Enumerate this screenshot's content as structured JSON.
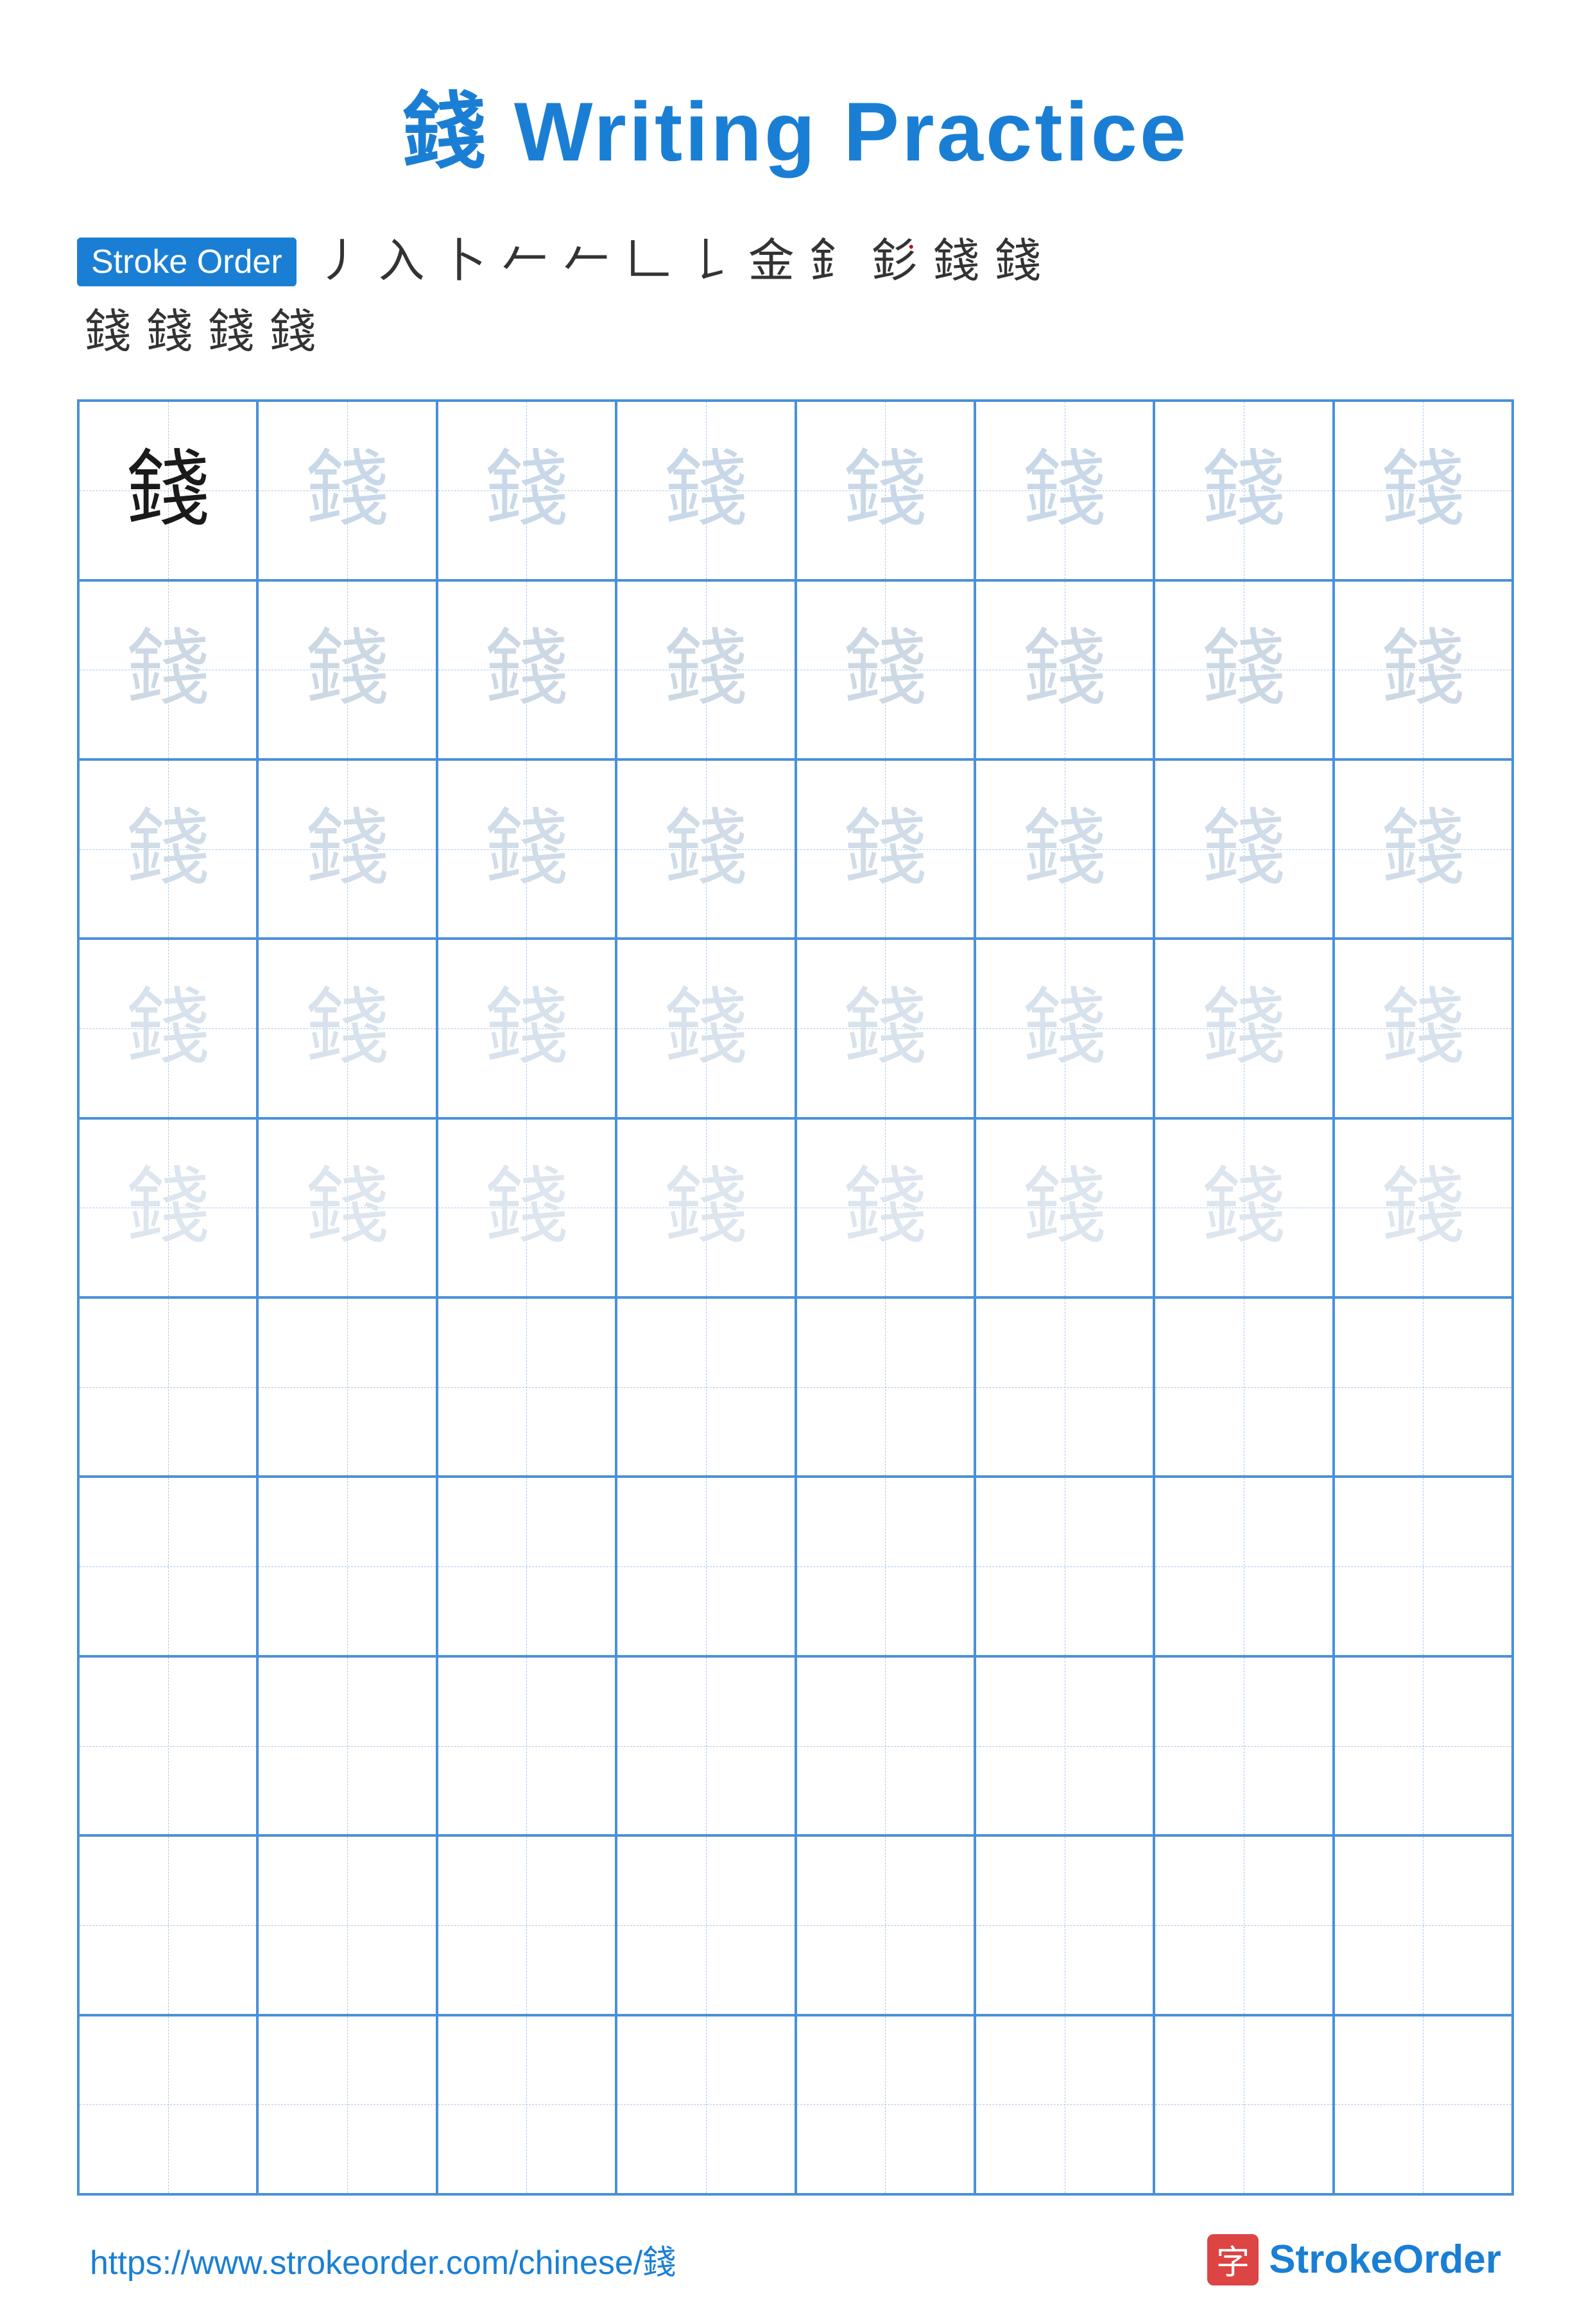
{
  "title": {
    "char": "錢",
    "text": " Writing Practice"
  },
  "stroke_order": {
    "badge_label": "Stroke Order",
    "strokes_row1": [
      "丿",
      "入",
      "卜",
      "土",
      "𠂉",
      "𠂉",
      "𠃊",
      "金",
      "金",
      "釒",
      "釤",
      "錢"
    ],
    "strokes_row2": [
      "錢",
      "錢",
      "錢",
      "錢"
    ]
  },
  "practice_char": "錢",
  "grid": {
    "cols": 8,
    "rows": 10,
    "filled_rows": 5,
    "empty_rows": 5
  },
  "footer": {
    "url": "https://www.strokeorder.com/chinese/錢",
    "brand_char": "字",
    "brand_text": "StrokeOrder"
  }
}
